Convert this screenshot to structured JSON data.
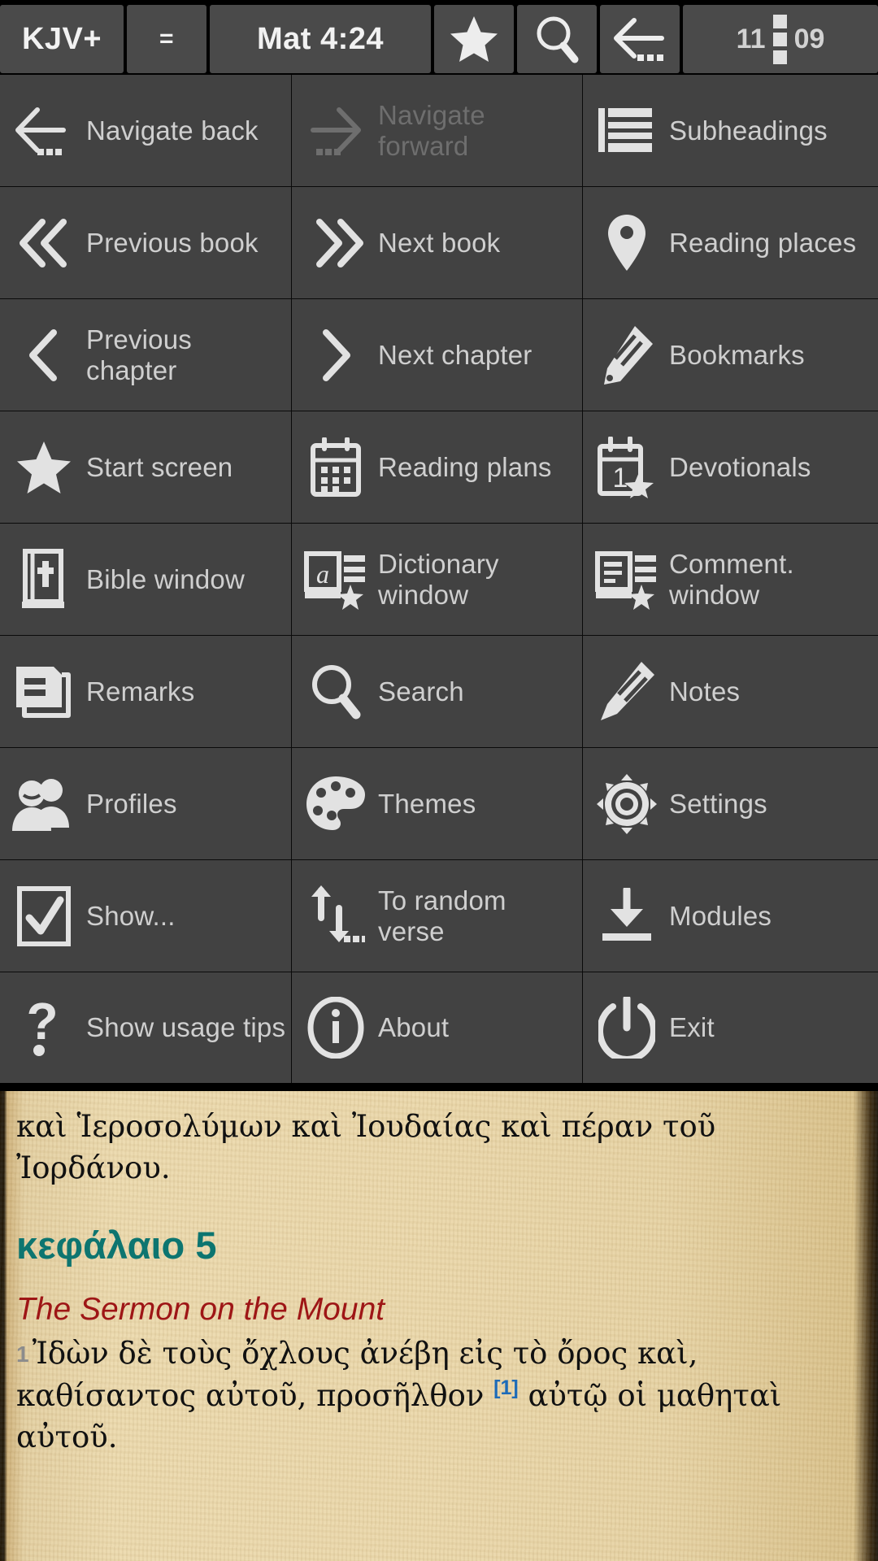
{
  "topbar": {
    "translation": "KJV+",
    "equals": "=",
    "reference": "Mat 4:24",
    "star_icon": "star-icon",
    "search_icon": "search-icon",
    "back_icon": "back-arrow-icon",
    "clock_hours": "11",
    "clock_minutes": "09",
    "menu_icon": "vertical-menu-icon"
  },
  "menu": {
    "items": [
      {
        "label": "Navigate back",
        "icon": "arrow-left-dots-icon",
        "disabled": false
      },
      {
        "label": "Navigate forward",
        "icon": "arrow-right-dots-icon",
        "disabled": true
      },
      {
        "label": "Subheadings",
        "icon": "subheadings-lines-icon",
        "disabled": false
      },
      {
        "label": "Previous book",
        "icon": "double-chevron-left-icon",
        "disabled": false
      },
      {
        "label": "Next book",
        "icon": "double-chevron-right-icon",
        "disabled": false
      },
      {
        "label": "Reading places",
        "icon": "map-pin-icon",
        "disabled": false
      },
      {
        "label": "Previous chapter",
        "icon": "chevron-left-icon",
        "disabled": false
      },
      {
        "label": "Next chapter",
        "icon": "chevron-right-icon",
        "disabled": false
      },
      {
        "label": "Bookmarks",
        "icon": "bookmark-ribbon-icon",
        "disabled": false
      },
      {
        "label": "Start screen",
        "icon": "star-icon",
        "disabled": false
      },
      {
        "label": "Reading plans",
        "icon": "calendar-grid-icon",
        "disabled": false
      },
      {
        "label": "Devotionals",
        "icon": "calendar-star-icon",
        "disabled": false
      },
      {
        "label": "Bible window",
        "icon": "bible-book-icon",
        "disabled": false
      },
      {
        "label": "Dictionary window",
        "icon": "dictionary-star-icon",
        "disabled": false
      },
      {
        "label": "Comment. window",
        "icon": "commentary-star-icon",
        "disabled": false
      },
      {
        "label": "Remarks",
        "icon": "remarks-note-icon",
        "disabled": false
      },
      {
        "label": "Search",
        "icon": "magnifier-icon",
        "disabled": false
      },
      {
        "label": "Notes",
        "icon": "pencil-icon",
        "disabled": false
      },
      {
        "label": "Profiles",
        "icon": "profiles-people-icon",
        "disabled": false
      },
      {
        "label": "Themes",
        "icon": "palette-icon",
        "disabled": false
      },
      {
        "label": "Settings",
        "icon": "gear-icon",
        "disabled": false
      },
      {
        "label": "Show...",
        "icon": "checkbox-checked-icon",
        "disabled": false
      },
      {
        "label": "To random verse",
        "icon": "up-down-arrows-dots-icon",
        "disabled": false
      },
      {
        "label": "Modules",
        "icon": "download-icon",
        "disabled": false
      },
      {
        "label": "Show usage tips",
        "icon": "question-mark-icon",
        "disabled": false
      },
      {
        "label": "About",
        "icon": "info-circle-icon",
        "disabled": false
      },
      {
        "label": "Exit",
        "icon": "power-icon",
        "disabled": false
      }
    ]
  },
  "reader": {
    "prev_verse_text": "καὶ Ἱεροσολύμων καὶ Ἰουδαίας καὶ πέραν τοῦ Ἰορδάνου.",
    "chapter_heading": "κεφάλαιο 5",
    "section_title": "The Sermon on the Mount",
    "verse_number": "1",
    "verse_text_part1": "Ἰδὼν δὲ τοὺς ὄχλους ἀνέβη εἰς τὸ ὄρος καὶ, καθίσαντος αὐτοῦ, προσῆλθον ",
    "footnote_marker": "[1]",
    "verse_text_part2": " αὐτῷ οἱ μαθηταὶ αὐτοῦ."
  },
  "colors": {
    "tile_bg": "#424242",
    "topbar_tile_bg": "#4a4a4a",
    "label_text": "#cfcfcf",
    "disabled_text": "#6e6e6e",
    "paper_bg": "#e8d5a8",
    "chapter_teal": "#0d7570",
    "section_red": "#9e1616",
    "footnote_blue": "#1d6bb8",
    "verse_num_gray": "#8c8c8c"
  }
}
